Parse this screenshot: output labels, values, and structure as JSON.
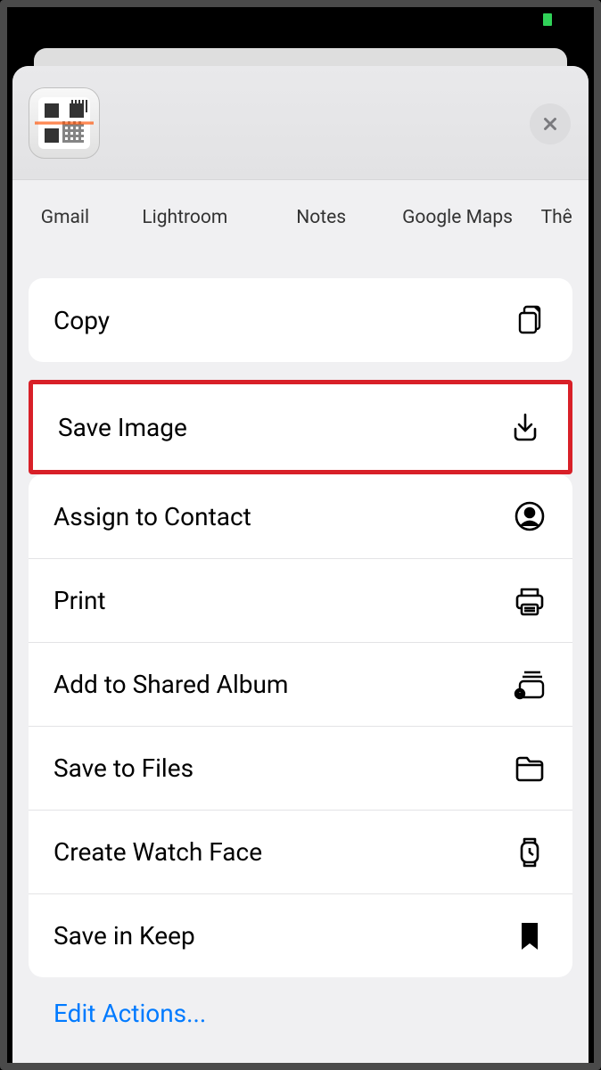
{
  "status": {
    "indicator_color": "#30d158"
  },
  "header": {
    "thumbnail_type": "qr-barcode-scanner"
  },
  "share_targets": [
    {
      "label": "Gmail",
      "icon_style": "gmail"
    },
    {
      "label": "Lightroom",
      "icon_style": "dark"
    },
    {
      "label": "Notes",
      "icon_style": "notes"
    },
    {
      "label": "Google Maps",
      "icon_style": "maps-pin"
    },
    {
      "label": "Thê",
      "icon_style": "partial"
    }
  ],
  "actions_primary": [
    {
      "label": "Copy",
      "icon": "copy"
    }
  ],
  "actions_secondary": [
    {
      "label": "Save Image",
      "icon": "download",
      "highlighted": true
    },
    {
      "label": "Assign to Contact",
      "icon": "contact"
    },
    {
      "label": "Print",
      "icon": "printer"
    },
    {
      "label": "Add to Shared Album",
      "icon": "shared-album"
    },
    {
      "label": "Save to Files",
      "icon": "folder"
    },
    {
      "label": "Create Watch Face",
      "icon": "watch"
    },
    {
      "label": "Save in Keep",
      "icon": "bookmark-filled"
    }
  ],
  "footer": {
    "edit_actions": "Edit Actions..."
  }
}
